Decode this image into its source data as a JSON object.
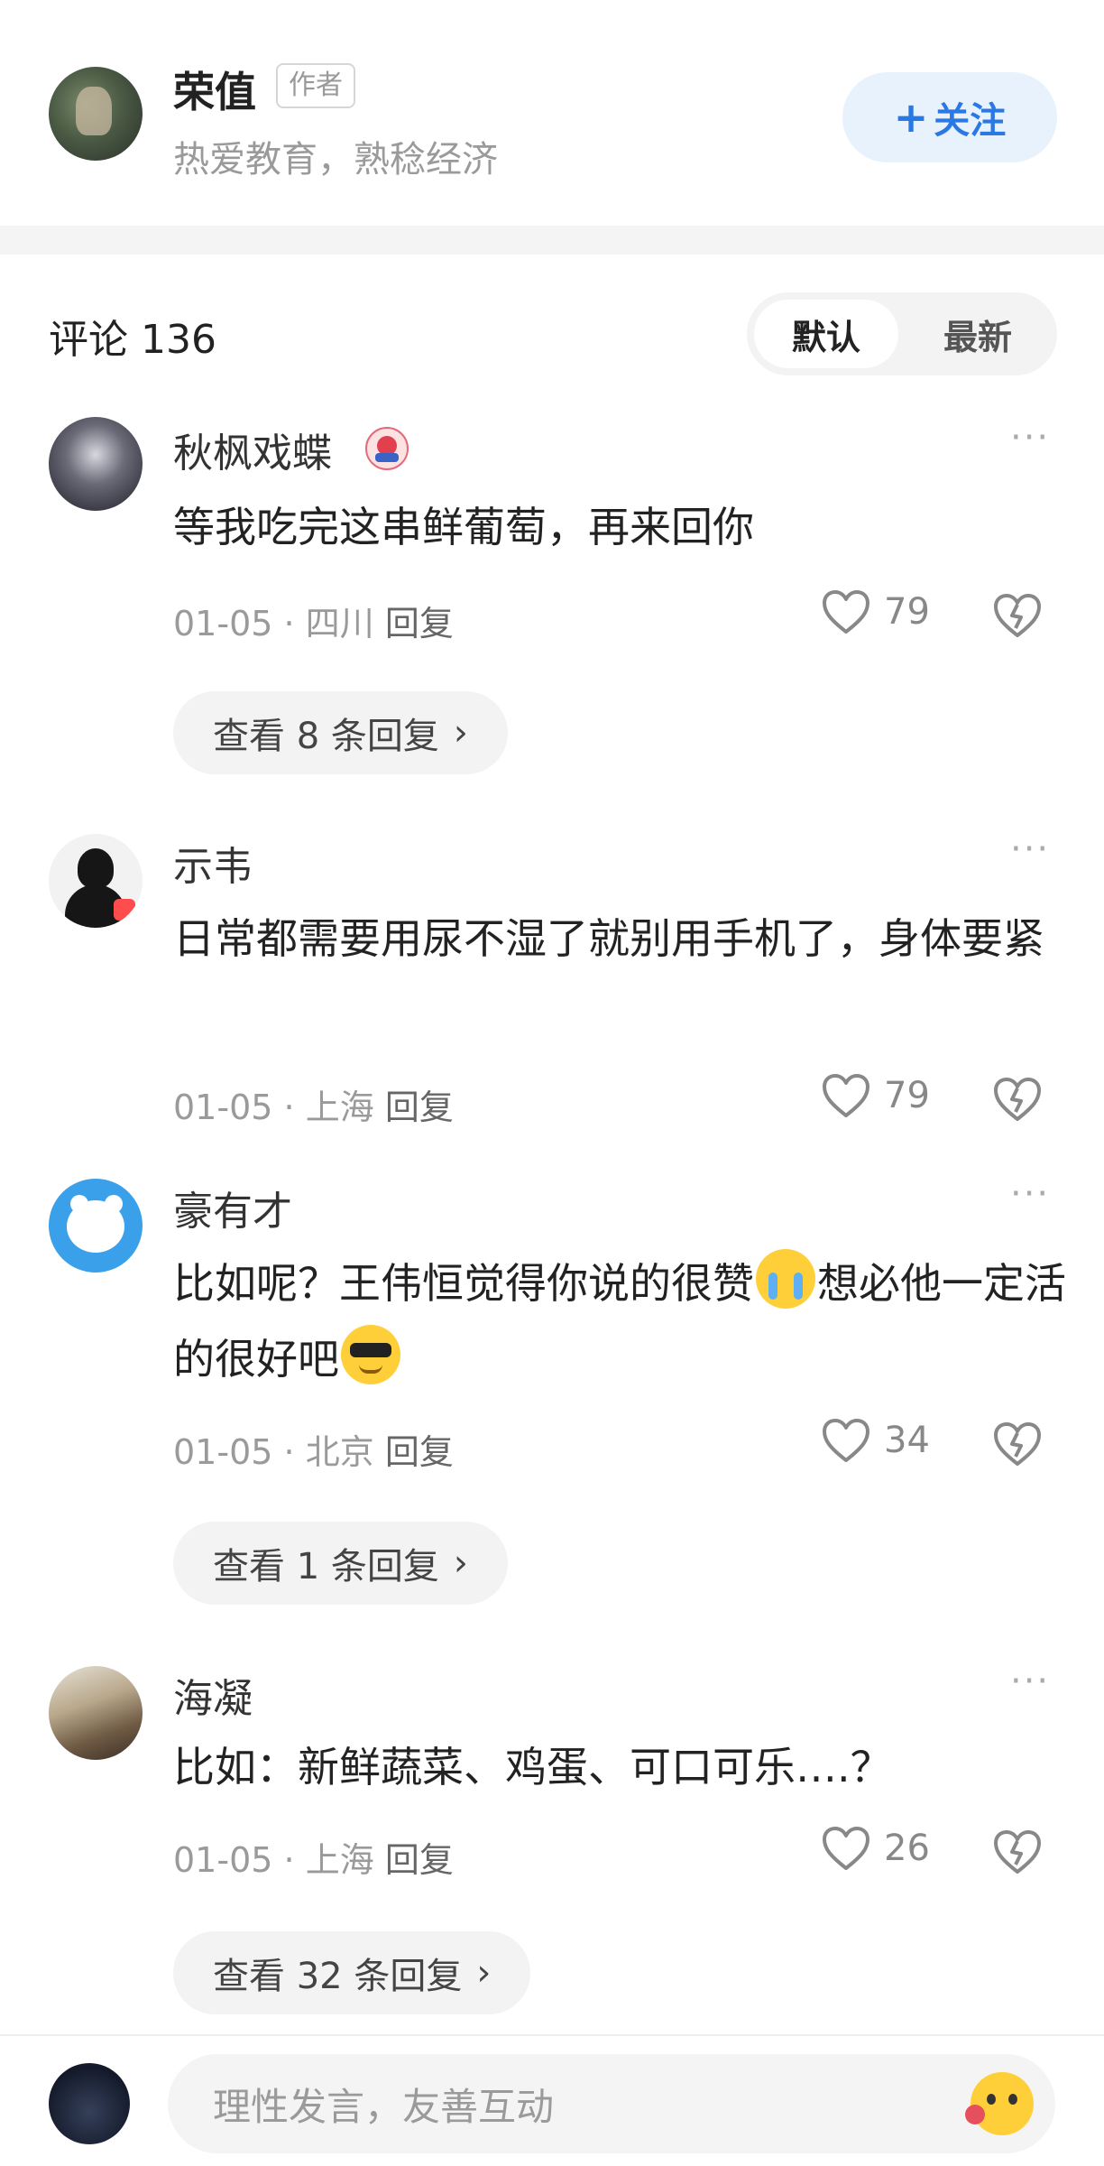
{
  "author": {
    "name": "荣值",
    "tag": "作者",
    "bio": "热爱教育，熟稔经济",
    "follow_label": "关注",
    "follow_plus": "+"
  },
  "comments_header": {
    "title": "评论 136",
    "sort_default": "默认",
    "sort_latest": "最新"
  },
  "comments": [
    {
      "user": "秋枫戏蝶",
      "text": "等我吃完这串鲜葡萄，再来回你",
      "date": "01-05",
      "location": "四川",
      "reply_label": "回复",
      "likes": "79",
      "view_replies": "查看 8 条回复"
    },
    {
      "user": "示韦",
      "text": "日常都需要用尿不湿了就别用手机了，身体要紧",
      "date": "01-05",
      "location": "上海",
      "reply_label": "回复",
      "likes": "79"
    },
    {
      "user": "豪有才",
      "text_part1": "比如呢？王伟恒觉得你说的很赞",
      "text_part2": "想必他一定活的很好吧",
      "date": "01-05",
      "location": "北京",
      "reply_label": "回复",
      "likes": "34",
      "view_replies": "查看 1 条回复"
    },
    {
      "user": "海凝",
      "text": "比如：新鲜蔬菜、鸡蛋、可口可乐….？",
      "date": "01-05",
      "location": "上海",
      "reply_label": "回复",
      "likes": "26",
      "view_replies": "查看 32 条回复"
    }
  ],
  "more_glyph": "···",
  "meta_separator": "·",
  "chevron": "›",
  "input": {
    "placeholder": "理性发言，友善互动"
  },
  "icons": {
    "like": "heart-outline-icon",
    "dislike": "broken-heart-icon",
    "more": "more-dots-icon",
    "emoji": "emoji-icon"
  },
  "colors": {
    "accent": "#2a78e4",
    "follow_bg": "#e8f2fd",
    "muted": "#9a9a9a"
  }
}
